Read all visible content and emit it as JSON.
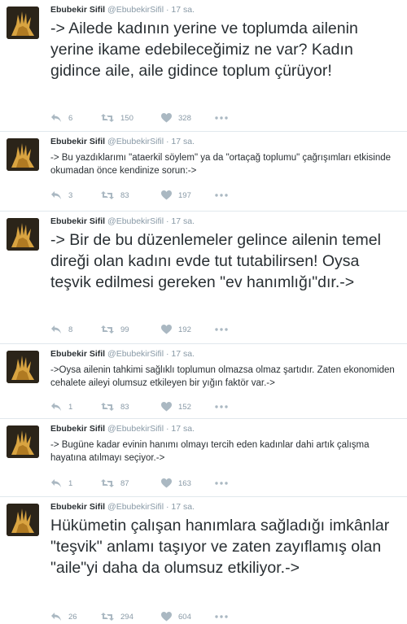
{
  "tweets": [
    {
      "name": "Ebubekir Sifil",
      "handle": "@EbubekirSifil",
      "separator": "·",
      "time": "17 sa.",
      "text": "-> Ailede kadının yerine ve toplumda ailenin yerine ikame edebileceğimiz ne var? Kadın gidince aile, aile gidince toplum çürüyor!",
      "replies": "6",
      "retweets": "150",
      "likes": "328"
    },
    {
      "name": "Ebubekir Sifil",
      "handle": "@EbubekirSifil",
      "separator": "·",
      "time": "17 sa.",
      "text": "-> Bu yazdıklarımı \"ataerkil söylem\" ya da \"ortaçağ toplumu\" çağrışımları etkisinde okumadan önce kendinize sorun:->",
      "replies": "3",
      "retweets": "83",
      "likes": "197"
    },
    {
      "name": "Ebubekir Sifil",
      "handle": "@EbubekirSifil",
      "separator": "·",
      "time": "17 sa.",
      "text": "-> Bir de bu düzenlemeler gelince ailenin temel direği olan kadını evde tut tutabilirsen! Oysa teşvik edilmesi gereken \"ev hanımlığı\"dır.->",
      "replies": "8",
      "retweets": "99",
      "likes": "192"
    },
    {
      "name": "Ebubekir Sifil",
      "handle": "@EbubekirSifil",
      "separator": "·",
      "time": "17 sa.",
      "text": "->Oysa ailenin tahkimi sağlıklı toplumun olmazsa olmaz şartıdır. Zaten ekonomiden cehalete aileyi olumsuz etkileyen bir yığın faktör var.->",
      "replies": "1",
      "retweets": "83",
      "likes": "152"
    },
    {
      "name": "Ebubekir Sifil",
      "handle": "@EbubekirSifil",
      "separator": "·",
      "time": "17 sa.",
      "text": "-> Bugüne kadar evinin hanımı olmayı tercih eden kadınlar dahi artık çalışma hayatına atılmayı seçiyor.->",
      "replies": "1",
      "retweets": "87",
      "likes": "163"
    },
    {
      "name": "Ebubekir Sifil",
      "handle": "@EbubekirSifil",
      "separator": "·",
      "time": "17 sa.",
      "text": "Hükümetin çalışan hanımlara sağladığı imkânlar \"teşvik\" anlamı taşıyor ve zaten zayıflamış olan \"aile\"yi daha da olumsuz etkiliyor.->",
      "replies": "26",
      "retweets": "294",
      "likes": "604"
    }
  ],
  "icons": {
    "reply": "reply-icon",
    "retweet": "retweet-icon",
    "like": "heart-icon",
    "more": "more-icon"
  },
  "colors": {
    "name": "#292f33",
    "meta": "#8899a6",
    "icon": "#aab8c2",
    "divider": "#e1e8ed"
  }
}
